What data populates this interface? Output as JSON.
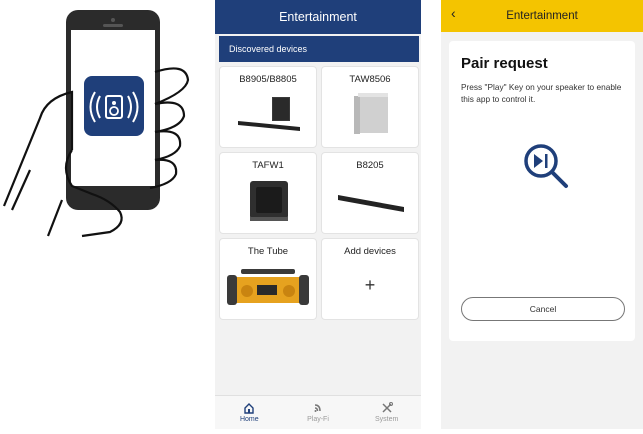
{
  "middle": {
    "header_title": "Entertainment",
    "discovered_label": "Discovered devices",
    "devices": [
      {
        "name": "B8905/B8805"
      },
      {
        "name": "TAW8506"
      },
      {
        "name": "TAFW1"
      },
      {
        "name": "B8205"
      },
      {
        "name": "The Tube"
      },
      {
        "name": "Add devices",
        "action_icon": "plus-icon"
      }
    ],
    "add_symbol": "+",
    "tabs": [
      {
        "label": "Home",
        "icon": "home-icon",
        "active": true
      },
      {
        "label": "Play-Fi",
        "icon": "playfi-icon",
        "active": false
      },
      {
        "label": "System",
        "icon": "tools-icon",
        "active": false
      }
    ]
  },
  "right": {
    "header_title": "Entertainment",
    "back_symbol": "‹",
    "pair_title": "Pair request",
    "pair_description": "Press \"Play\" Key on your speaker to enable this app to control it.",
    "cancel_label": "Cancel"
  },
  "colors": {
    "mid_header": "#1f3f7a",
    "right_header": "#f4c400",
    "app_icon": "#1f3f7a"
  }
}
